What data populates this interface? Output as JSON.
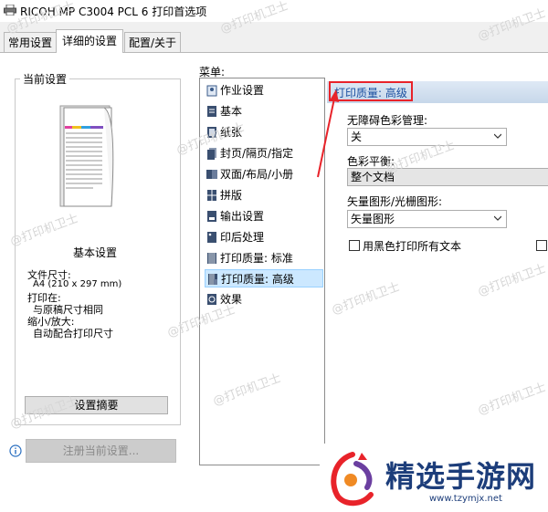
{
  "window": {
    "title": "RICOH MP C3004 PCL 6 打印首选项",
    "icon": "printer-icon"
  },
  "tabs": [
    {
      "label": "常用设置",
      "active": false
    },
    {
      "label": "详细的设置",
      "active": true
    },
    {
      "label": "配置/关于",
      "active": false
    }
  ],
  "current_settings": {
    "title": "当前设置",
    "preview_caption": "基本设置",
    "paper_size_label": "文件尺寸:",
    "paper_size_value": "A4 (210 x 297 mm)",
    "print_on_label": "打印在:",
    "print_on_value": "与原稿尺寸相同",
    "zoom_label": "缩小/放大:",
    "zoom_value": "自动配合打印尺寸",
    "summary_button": "设置摘要",
    "register_button": "注册当前设置...",
    "info_icon": "info-icon"
  },
  "menu": {
    "label": "菜单:",
    "items": [
      {
        "label": "作业设置",
        "icon": "job-icon"
      },
      {
        "label": "基本",
        "icon": "document-icon"
      },
      {
        "label": "纸张",
        "icon": "paper-icon"
      },
      {
        "label": "封页/隔页/指定",
        "icon": "cover-icon"
      },
      {
        "label": "双面/布局/小册",
        "icon": "duplex-icon"
      },
      {
        "label": "拼版",
        "icon": "imposition-icon"
      },
      {
        "label": "输出设置",
        "icon": "output-icon"
      },
      {
        "label": "印后处理",
        "icon": "finishing-icon"
      },
      {
        "label": "打印质量: 标准",
        "icon": "quality-standard-icon"
      },
      {
        "label": "打印质量: 高级",
        "icon": "quality-advanced-icon",
        "selected": true
      },
      {
        "label": "效果",
        "icon": "effect-icon"
      }
    ]
  },
  "panel": {
    "title": "打印质量: 高级",
    "color_management_label": "无障碍色彩管理:",
    "color_management_value": "关",
    "color_balance_label": "色彩平衡:",
    "color_balance_value": "整个文档",
    "vector_label": "矢量图形/光栅图形:",
    "vector_value": "矢量图形",
    "black_text_label": "用黑色打印所有文本"
  },
  "watermark": {
    "text": "@打印机卫士",
    "brand_name": "精选手游网",
    "brand_url": "www.tzymjx.net"
  },
  "colors": {
    "highlight": "#e8232a",
    "selection": "#cce8ff",
    "brand_red": "#e8232a",
    "brand_purple": "#6b3fa0",
    "brand_text": "#1c3d7a"
  }
}
